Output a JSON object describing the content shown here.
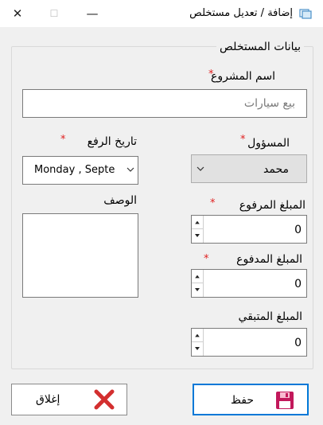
{
  "window": {
    "title": "إضافة / تعديل مستخلص",
    "close_glyph": "✕",
    "maximize_glyph": "☐",
    "minimize_glyph": "—"
  },
  "group": {
    "title": "بيانات المستخلص"
  },
  "fields": {
    "project_name": {
      "label": "اسم المشروع",
      "required": "*",
      "value": "بيع سيارات"
    },
    "upload_date": {
      "label": "تاريخ الرفع",
      "required": "*",
      "value": "Monday   , Septe"
    },
    "responsible": {
      "label": "المسؤول",
      "required": "*",
      "value": "محمد"
    },
    "description": {
      "label": "الوصف",
      "value": ""
    },
    "uploaded_amount": {
      "label": "المبلغ المرفوع",
      "required": "*",
      "value": "0"
    },
    "paid_amount": {
      "label": "المبلغ المدفوع",
      "required": "*",
      "value": "0"
    },
    "remaining_amount": {
      "label": "المبلغ المتبقي",
      "value": "0"
    }
  },
  "buttons": {
    "save": {
      "label": "حفظ",
      "icon": "floppy-disk-icon"
    },
    "close": {
      "label": "إغلاق",
      "icon": "red-x-icon"
    }
  },
  "colors": {
    "accent": "#0078d7",
    "required": "#e02020",
    "save_icon": "#c2185b",
    "close_icon": "#d32f2f"
  }
}
